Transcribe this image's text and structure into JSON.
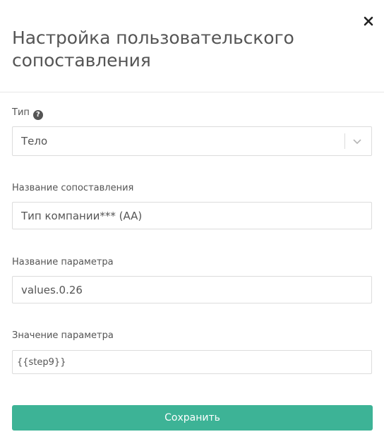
{
  "dialog": {
    "title": "Настройка пользовательского сопоставления",
    "close_icon": "close-icon"
  },
  "fields": {
    "type": {
      "label": "Тип",
      "help_icon": "question-circle-icon",
      "help_glyph": "?",
      "value": "Тело",
      "arrow_icon": "chevron-down-icon"
    },
    "mapping_name": {
      "label": "Название сопоставления",
      "value": "Тип компании*** (AA)"
    },
    "param_name": {
      "label": "Название параметра",
      "value": "values.0.26"
    },
    "param_value": {
      "label": "Значение параметра",
      "value": "{{step9}}"
    }
  },
  "actions": {
    "save_label": "Сохранить"
  },
  "colors": {
    "accent": "#3db396",
    "text": "#555555",
    "border": "#dcdcdc"
  }
}
